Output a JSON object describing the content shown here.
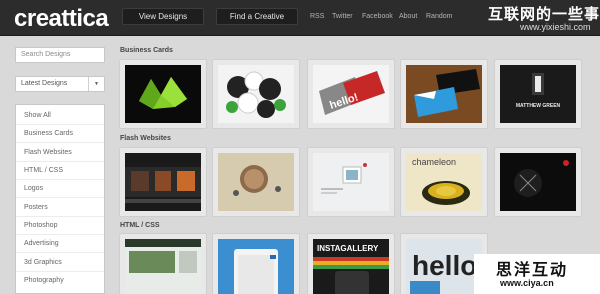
{
  "header": {
    "logo": "creattica",
    "nav_buttons": [
      "View Designs",
      "Find a Creative"
    ],
    "nav_links": [
      "RSS",
      "Twitter",
      "Facebook",
      "About",
      "Random"
    ],
    "watermark_top": "互联网的一些事",
    "watermark_top_sub": "www.yixieshi.com"
  },
  "sidebar": {
    "search_placeholder": "Search Designs",
    "sort_selected": "Latest Designs",
    "menu": [
      "Show All",
      "Business Cards",
      "Flash Websites",
      "HTML / CSS",
      "Logos",
      "Posters",
      "Photoshop",
      "Advertising",
      "3d Graphics",
      "Photography"
    ]
  },
  "sections": [
    {
      "title": "Business Cards"
    },
    {
      "title": "Flash Websites"
    },
    {
      "title": "HTML / CSS"
    }
  ],
  "thumb_text": {
    "hello": "hello!",
    "matthew": "MATTHEW GREEN",
    "chameleon": "chameleon",
    "instagallery": "INSTAGALLERY",
    "hello2": "hello"
  },
  "watermark_bottom": {
    "title": "思洋互动",
    "url": "www.ciya.cn"
  }
}
